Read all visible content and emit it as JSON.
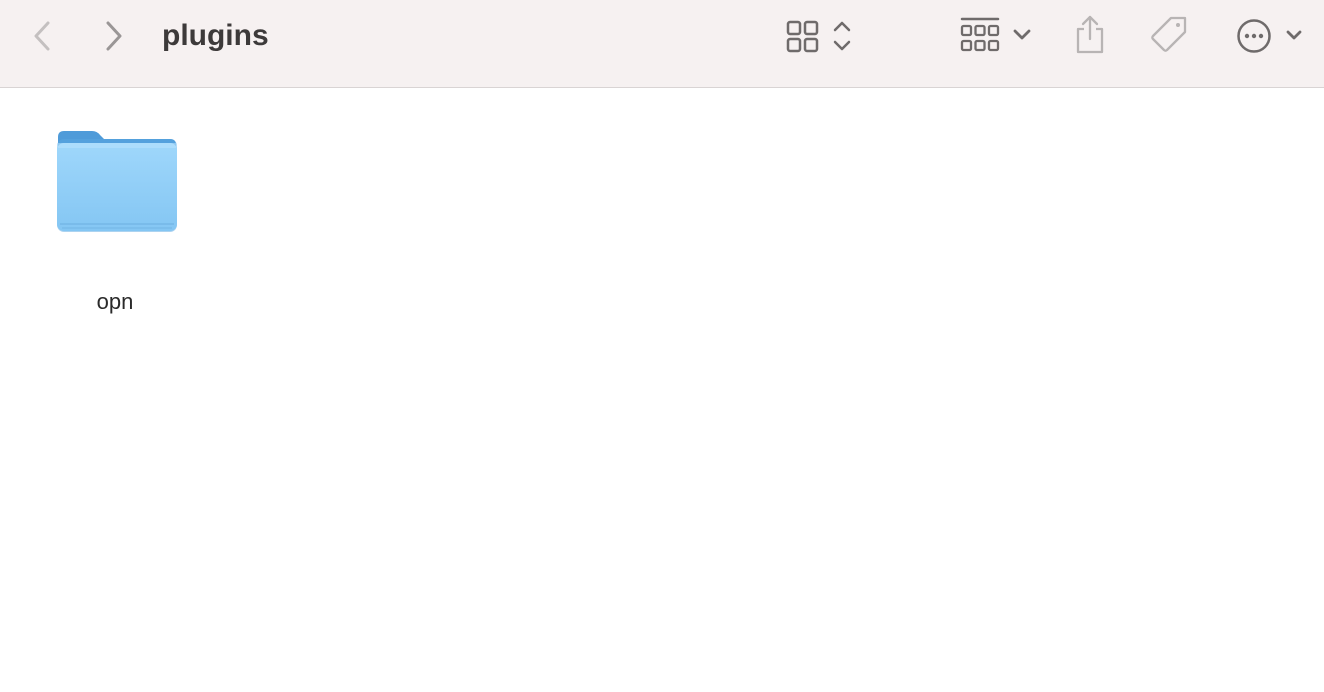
{
  "window": {
    "title": "plugins"
  },
  "toolbar": {
    "back_icon": "chevron-left-icon",
    "forward_icon": "chevron-right-icon",
    "view_icon": "icon-grid-icon",
    "group_icon": "group-grid-icon",
    "share_icon": "share-icon",
    "tag_icon": "tag-icon",
    "more_icon": "ellipsis-circle-icon"
  },
  "items": [
    {
      "name": "opn",
      "kind": "folder",
      "icon": "folder-icon",
      "color": "#8ecdf7"
    }
  ],
  "colors": {
    "toolbar_bg": "#f6f1f1",
    "folder_front": "#8ecdf7",
    "folder_back": "#4f9bd9"
  }
}
